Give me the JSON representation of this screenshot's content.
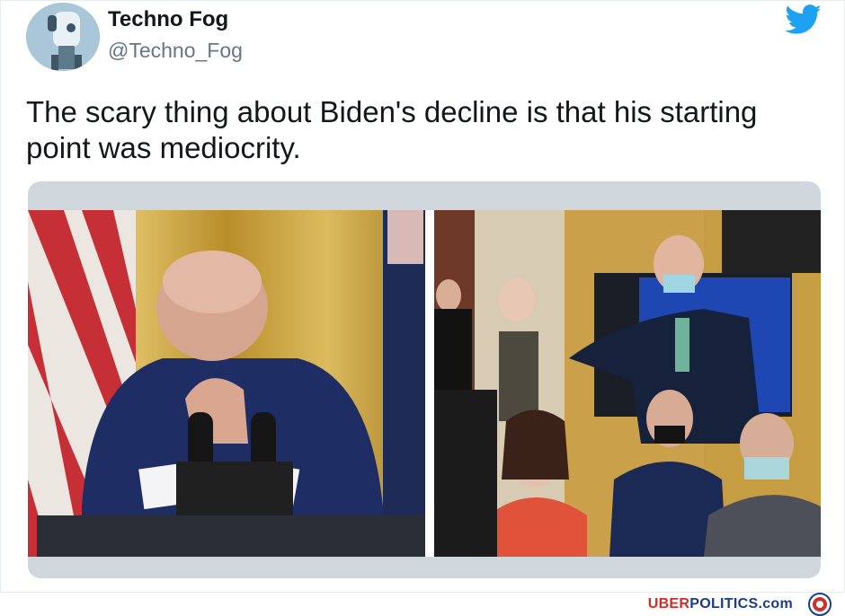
{
  "tweet": {
    "display_name": "Techno Fog",
    "handle": "@Techno_Fog",
    "text": "The scary thing about Biden's decline is that his starting point was mediocrity.",
    "logo_icon": "twitter-bird-icon",
    "accent_color": "#1da1f2"
  },
  "media": {
    "left_image": "speaker-at-podium-photo",
    "right_image": "press-room-reporters-photo"
  },
  "footer": {
    "brand_part1": "UBER",
    "brand_part2": "POLITICS.com",
    "badge_icon": "uberpolitics-badge-icon",
    "brand_red": "#d42a2a",
    "brand_blue": "#1d3b8b"
  }
}
